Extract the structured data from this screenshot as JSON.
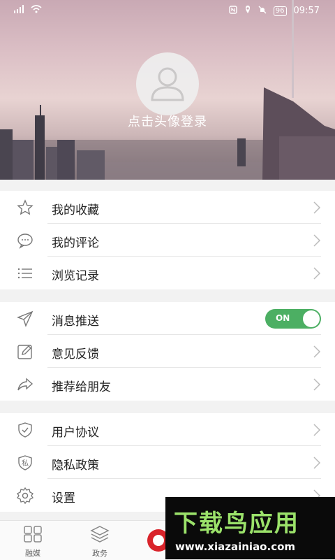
{
  "status_bar": {
    "battery": "96",
    "time": "09:57"
  },
  "profile": {
    "login_prompt": "点击头像登录"
  },
  "menu_group_1": [
    {
      "label": "我的收藏"
    },
    {
      "label": "我的评论"
    },
    {
      "label": "浏览记录"
    }
  ],
  "menu_group_2": [
    {
      "label": "消息推送",
      "toggle_text": "ON"
    },
    {
      "label": "意见反馈"
    },
    {
      "label": "推荐给朋友"
    }
  ],
  "menu_group_3": [
    {
      "label": "用户协议"
    },
    {
      "label": "隐私政策"
    },
    {
      "label": "设置"
    }
  ],
  "privacy_icon_char": "私",
  "bottom_nav": [
    {
      "label": "融媒",
      "icon": "grid-icon"
    },
    {
      "label": "政务",
      "icon": "layers-icon"
    }
  ],
  "watermark": {
    "title": "下载鸟应用",
    "url": "www.xiazainiao.com"
  },
  "colors": {
    "toggle_on": "#4caf63",
    "watermark_green": "#9be26a"
  }
}
